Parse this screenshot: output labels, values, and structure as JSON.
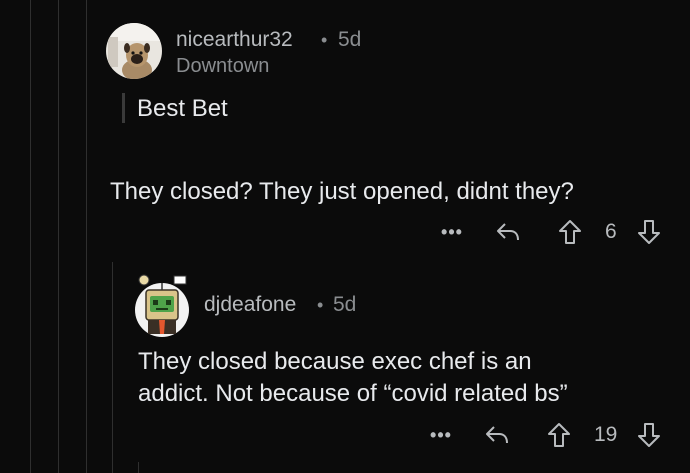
{
  "comments": [
    {
      "username": "nicearthur32",
      "separator": "•",
      "age": "5d",
      "flair": "Downtown",
      "quote": "Best Bet",
      "body": "They closed? They just opened, didnt they?",
      "vote_count": "6",
      "avatar_icon": "pug-photo-avatar",
      "more_label": "•••"
    },
    {
      "username": "djdeafone",
      "separator": "•",
      "age": "5d",
      "body_line1": "They closed because exec chef is an",
      "body_line2": "addict. Not because of “covid related bs”",
      "vote_count": "19",
      "avatar_icon": "robot-avatar",
      "more_label": "•••"
    }
  ],
  "colors": {
    "background": "#0b0b0b",
    "text": "#e8eaed",
    "meta": "#8a8d90",
    "thread_line": "#2f2f2f"
  }
}
